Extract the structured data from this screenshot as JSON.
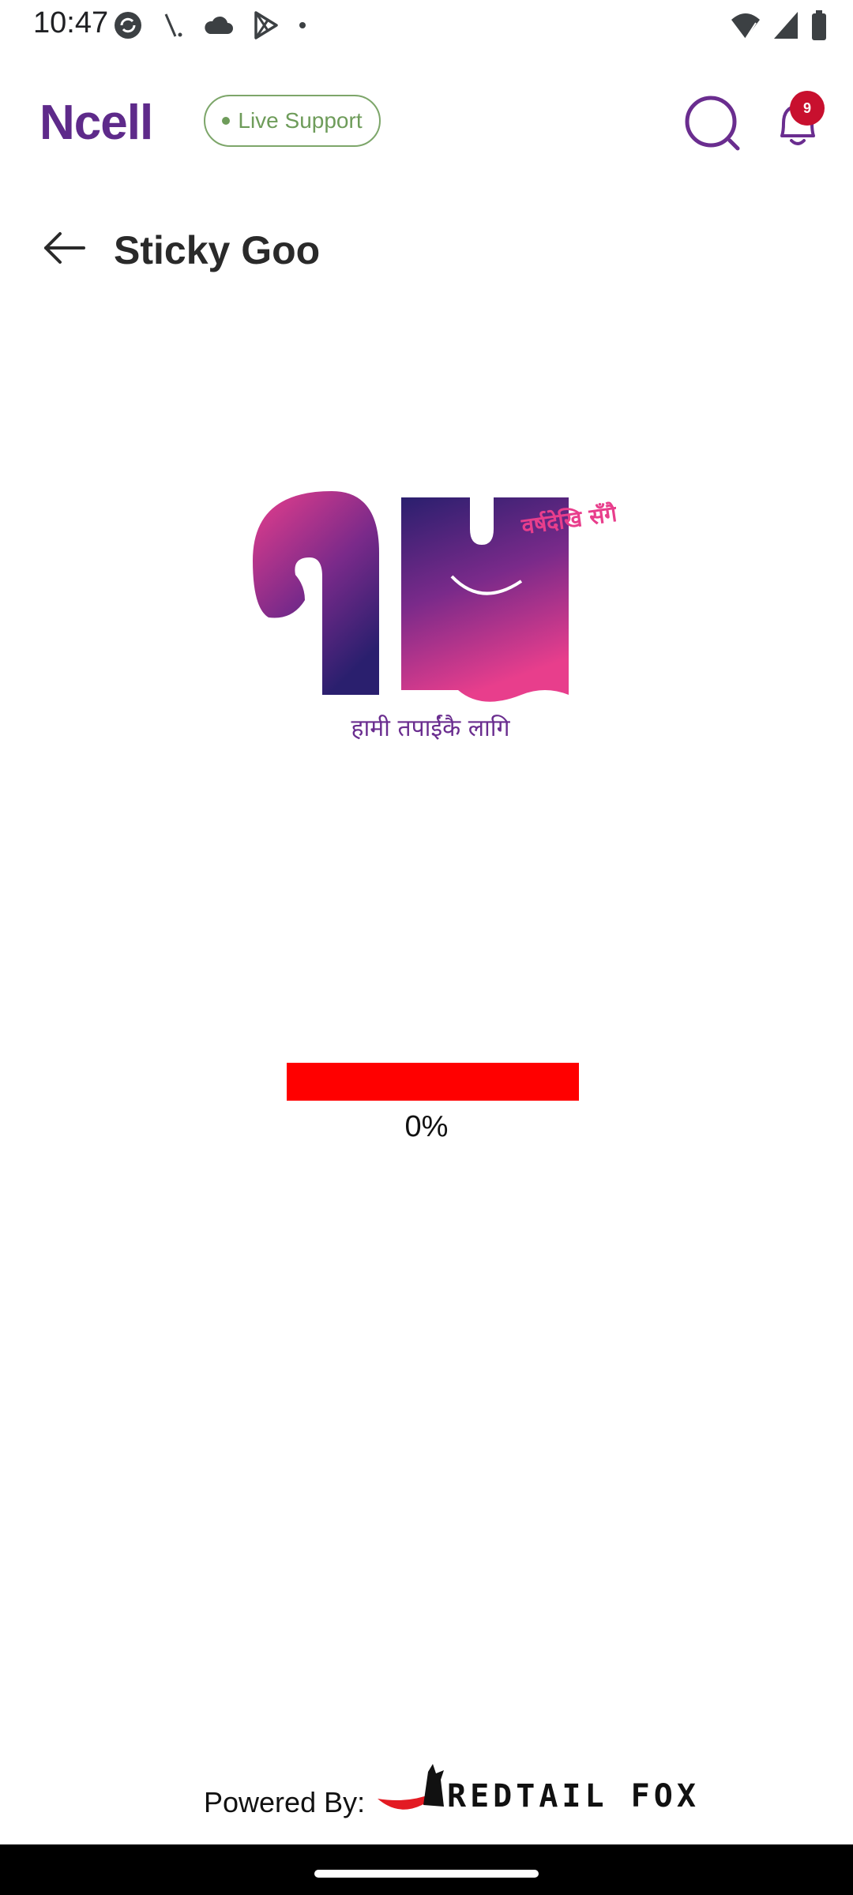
{
  "status_bar": {
    "time": "10:47",
    "left_icons": [
      "sync-icon",
      "signal-slash-icon",
      "cloud-icon",
      "play-store-icon",
      "dot-icon"
    ],
    "right_icons": [
      "wifi-icon",
      "cellular-icon",
      "battery-icon"
    ]
  },
  "header": {
    "brand": "Ncell",
    "live_support_label": "Live Support",
    "notification_count": "9",
    "brand_color": "#5e2a8a",
    "live_color": "#6e9c5a"
  },
  "title_bar": {
    "title": "Sticky Goo"
  },
  "splash": {
    "logo_number": "१५",
    "logo_script": "वर्षदेखि सँगै",
    "tagline": "हामी तपाईंकै लागि"
  },
  "progress": {
    "value_percent": 0,
    "text": "0%",
    "track_color": "#ff0000"
  },
  "footer": {
    "powered_by_label": "Powered By:",
    "partner_name": "REDTAIL FOX"
  }
}
